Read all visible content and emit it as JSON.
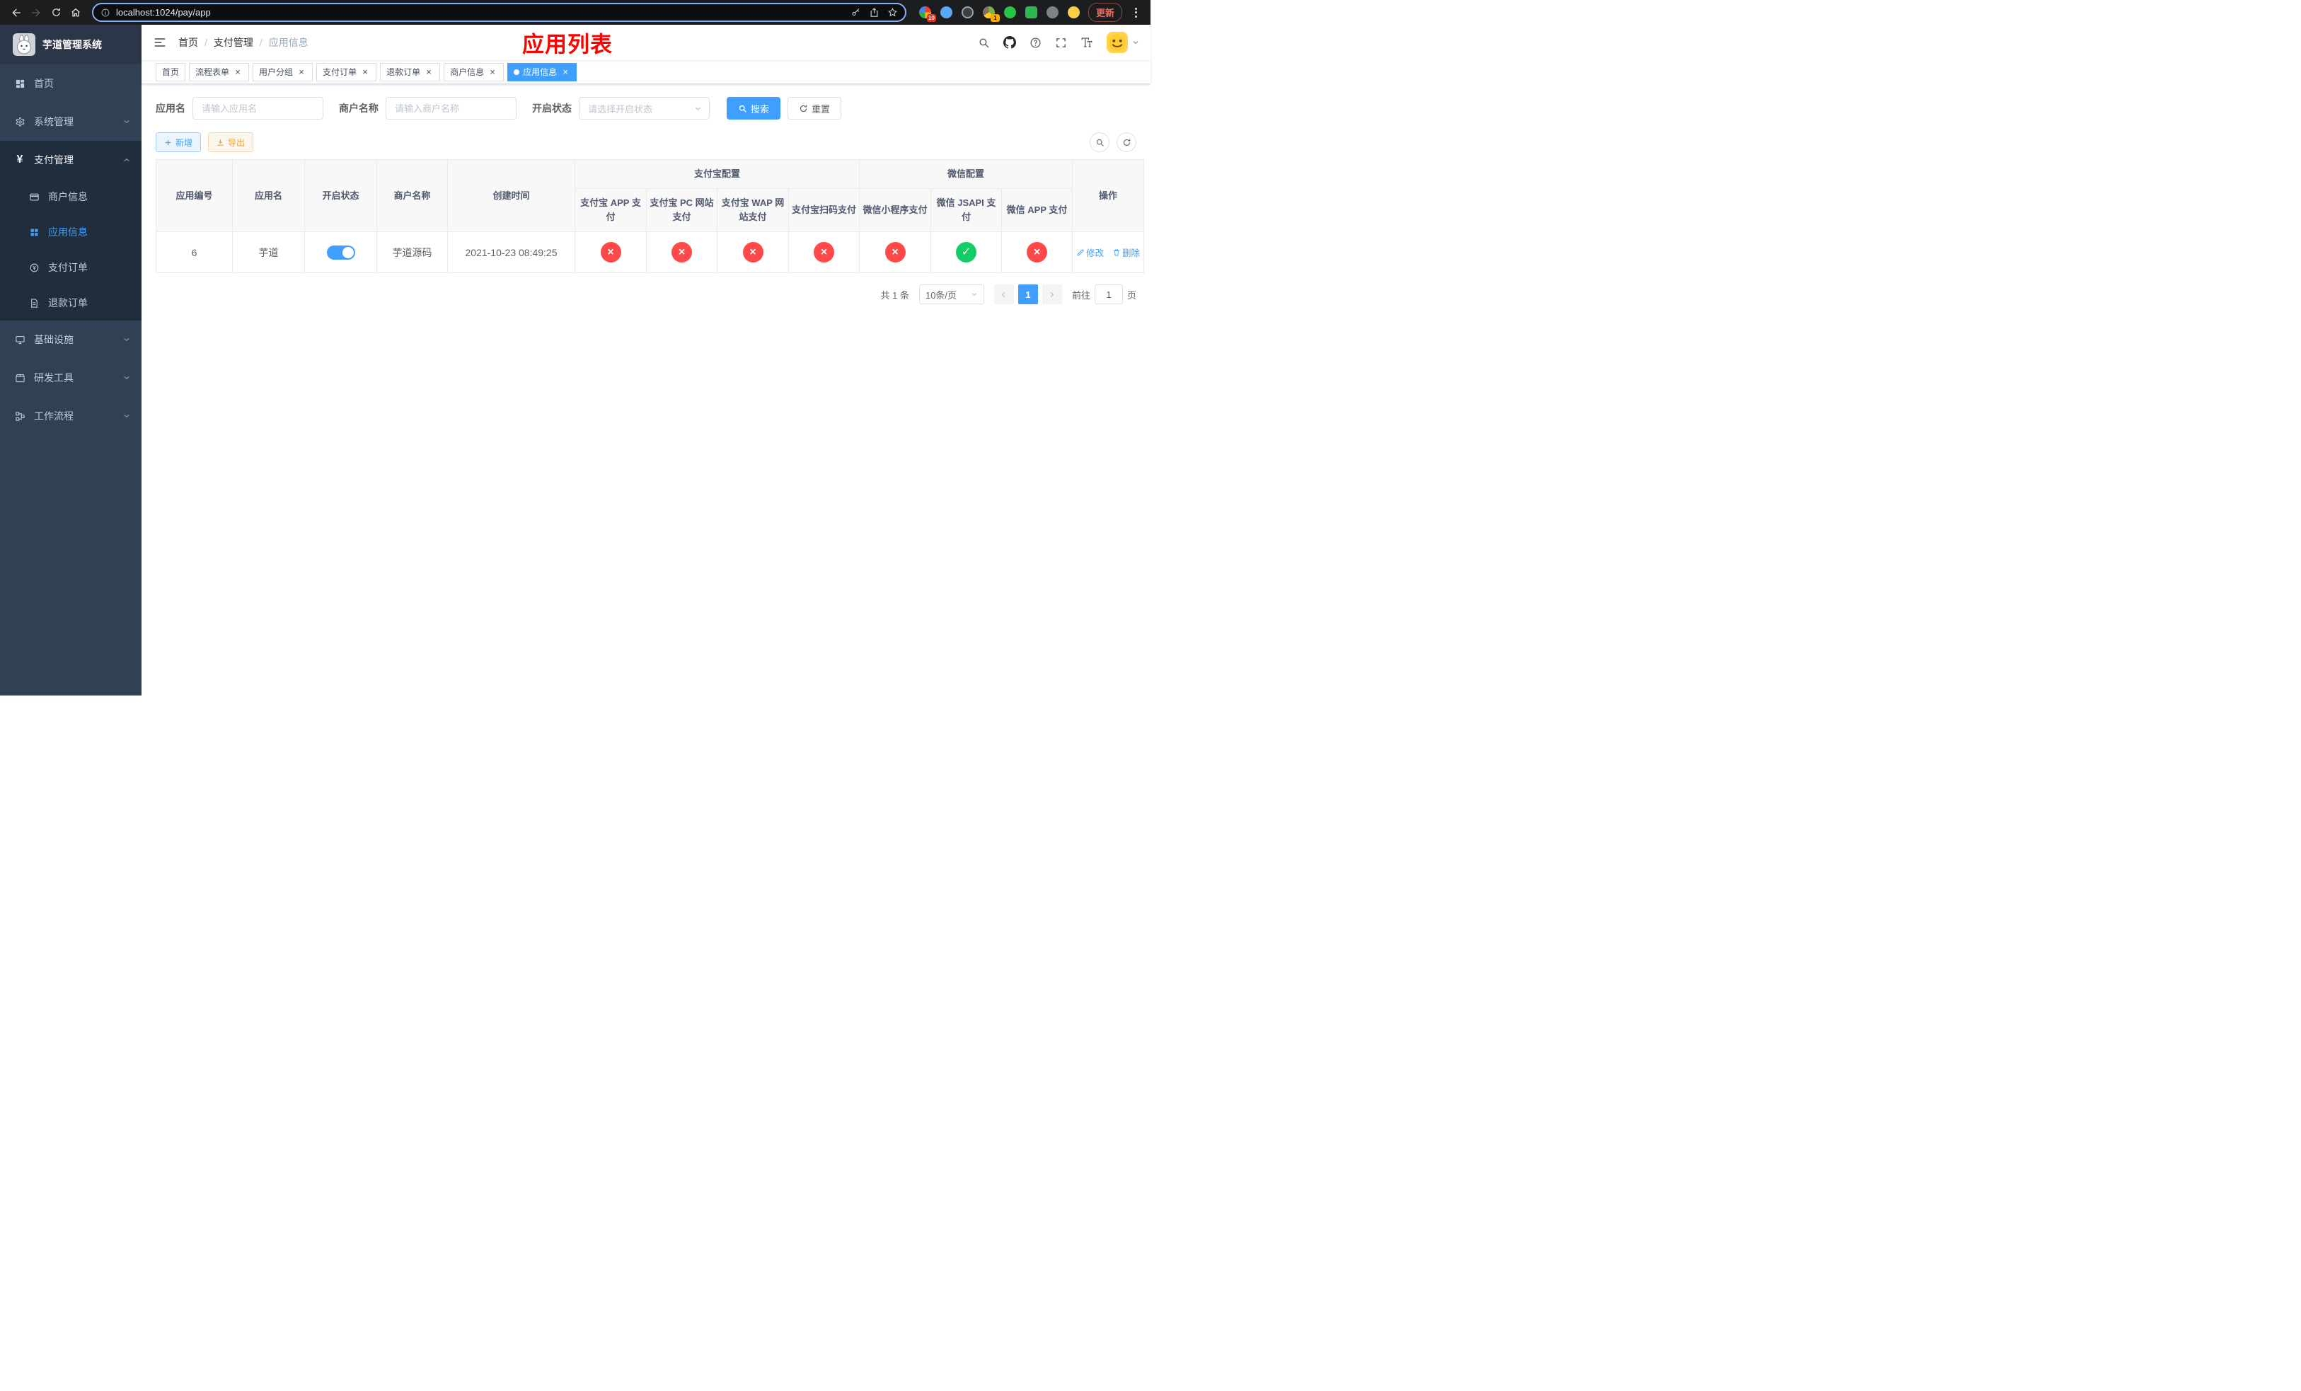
{
  "icons": {
    "close": "×",
    "check": "✓",
    "cross": "×",
    "yen": "¥"
  },
  "colors": {
    "accent": "#409eff",
    "danger": "#ff4949",
    "success": "#13ce66",
    "annotation": "#fe0000"
  },
  "browser": {
    "url": "localhost:1024/pay/app",
    "update_label": "更新",
    "ext_badge_first": "10",
    "ext_badge_second": "1"
  },
  "sidebar": {
    "title": "芋道管理系统",
    "items": {
      "home": "首页",
      "system": "系统管理",
      "payment": "支付管理",
      "merchant_info": "商户信息",
      "app_info": "应用信息",
      "pay_order": "支付订单",
      "refund_order": "退款订单",
      "infra": "基础设施",
      "dev_tools": "研发工具",
      "workflow": "工作流程"
    }
  },
  "navbar": {
    "breadcrumb": [
      "首页",
      "支付管理",
      "应用信息"
    ],
    "separator": "/",
    "annotation": "应用列表"
  },
  "tags": [
    "首页",
    "流程表单",
    "用户分组",
    "支付订单",
    "退款订单",
    "商户信息",
    "应用信息"
  ],
  "filters": {
    "app_name_label": "应用名",
    "app_name_placeholder": "请输入应用名",
    "merchant_label": "商户名称",
    "merchant_placeholder": "请输入商户名称",
    "status_label": "开启状态",
    "status_placeholder": "请选择开启状态",
    "search_label": "搜索",
    "reset_label": "重置"
  },
  "toolbar": {
    "add_label": "新增",
    "export_label": "导出"
  },
  "table": {
    "headers": {
      "app_id": "应用编号",
      "app_name": "应用名",
      "status": "开启状态",
      "merchant": "商户名称",
      "created": "创建时间",
      "alipay_group": "支付宝配置",
      "wechat_group": "微信配置",
      "alipay_app": "支付宝 APP 支付",
      "alipay_pc": "支付宝 PC 网站支付",
      "alipay_wap": "支付宝 WAP 网站支付",
      "alipay_qr": "支付宝扫码支付",
      "wx_lite": "微信小程序支付",
      "wx_jsapi": "微信 JSAPI 支付",
      "wx_app": "微信 APP 支付",
      "actions": "操作"
    },
    "rows": [
      {
        "app_id": "6",
        "app_name": "芋道",
        "status_on": true,
        "merchant": "芋道源码",
        "created": "2021-10-23 08:49:25",
        "configs": {
          "alipay_app": "disabled",
          "alipay_pc": "disabled",
          "alipay_wap": "disabled",
          "alipay_qr": "disabled",
          "wx_lite": "disabled",
          "wx_jsapi": "enabled",
          "wx_app": "disabled"
        },
        "edit_label": "修改",
        "delete_label": "删除"
      }
    ]
  },
  "pagination": {
    "total_text": "共 1 条",
    "page_size": "10条/页",
    "current_page": "1",
    "goto_prefix": "前往",
    "goto_value": "1",
    "goto_suffix": "页"
  }
}
